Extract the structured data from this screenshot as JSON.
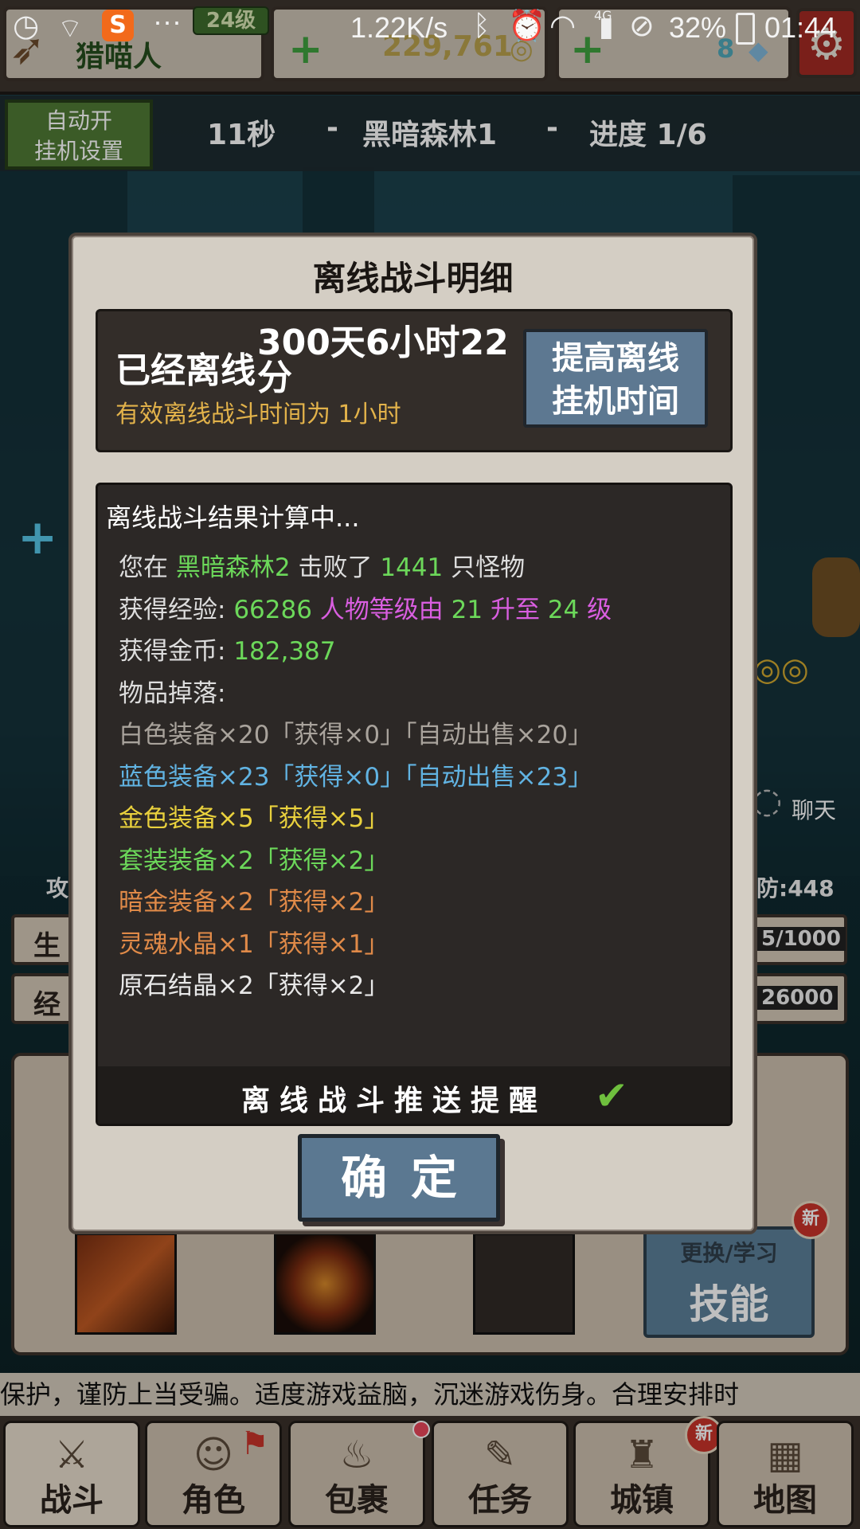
{
  "status_bar": {
    "net_speed": "1.22K/s",
    "battery": "32%",
    "time": "01:44",
    "signal": "4G",
    "dots": "···"
  },
  "header": {
    "level_badge": "24级",
    "char_name": "猎喵人",
    "gold": "229,761",
    "gems": "8"
  },
  "stage": {
    "auto_line1": "自动开",
    "auto_line2": "挂机设置",
    "timer": "11秒",
    "dash": "-",
    "name": "黑暗森林1",
    "progress": "进度 1/6"
  },
  "behind": {
    "atk_short": "攻",
    "def_val": "防:448",
    "hp_label": "生",
    "hp_val": "5/1000",
    "exp_label": "经",
    "exp_val": "26000",
    "chat": "聊天",
    "skill_top": "更换/学习",
    "skill_main": "技能",
    "new": "新"
  },
  "ticker": "保护，谨防上当受骗。适度游戏益脑，沉迷游戏伤身。合理安排时",
  "nav": [
    {
      "label": "战斗",
      "icon": "swords-icon"
    },
    {
      "label": "角色",
      "icon": "character-icon"
    },
    {
      "label": "包裹",
      "icon": "bag-icon"
    },
    {
      "label": "任务",
      "icon": "quest-icon"
    },
    {
      "label": "城镇",
      "icon": "town-icon"
    },
    {
      "label": "地图",
      "icon": "map-icon"
    }
  ],
  "modal": {
    "title": "离线战斗明细",
    "offline_label": "已经离线",
    "offline_time": "300天6小时22分",
    "effective": "有效离线战斗时间为 1小时",
    "raise_btn_line1": "提高离线",
    "raise_btn_line2": "挂机时间",
    "calc": "离线战斗结果计算中...",
    "kill": {
      "pre": "您在",
      "zone": "黑暗森林2",
      "mid": "击败了",
      "count": "1441",
      "post": "只怪物"
    },
    "exp": {
      "label": "获得经验:",
      "value": "66286",
      "t1": "人物等级由",
      "from": "21",
      "t2": "升至",
      "to": "24",
      "t3": "级"
    },
    "gold": {
      "label": "获得金币:",
      "value": "182,387"
    },
    "drops_label": "物品掉落:",
    "drops": [
      {
        "text": "白色装备×20「获得×0」「自动出售×20」",
        "color": "#a9a39c"
      },
      {
        "text": "蓝色装备×23「获得×0」「自动出售×23」",
        "color": "#61b3e2"
      },
      {
        "text": "金色装备×5「获得×5」",
        "color": "#e9d13d"
      },
      {
        "text": "套装装备×2「获得×2」",
        "color": "#6cd85a"
      },
      {
        "text": "暗金装备×2「获得×2」",
        "color": "#e08a48"
      },
      {
        "text": "灵魂水晶×1「获得×1」",
        "color": "#e08a48"
      },
      {
        "text": "原石结晶×2「获得×2」",
        "color": "#e8e8e8"
      }
    ],
    "push_label": "离线战斗推送提醒",
    "confirm": "确定"
  }
}
